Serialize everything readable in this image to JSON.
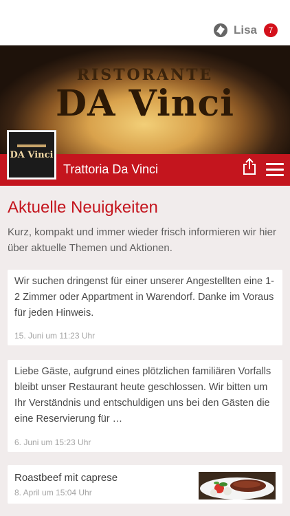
{
  "header": {
    "user_name": "Lisa",
    "notification_count": "7",
    "logo_icon": "lisa-app-icon"
  },
  "hero": {
    "sign_line1": "RISTORANTE",
    "sign_line2": "DA Vinci"
  },
  "business": {
    "name": "Trattoria Da Vinci",
    "logo_text": "DA Vinci",
    "share_icon": "share-icon",
    "menu_icon": "hamburger-menu-icon"
  },
  "news": {
    "title": "Aktuelle Neuigkeiten",
    "intro": "Kurz, kompakt und immer wieder frisch informieren wir hier über aktuelle Themen und Aktionen.",
    "items": [
      {
        "text": "Wir suchen dringenst für einer unserer Angestellten eine 1-2 Zimmer oder Appartment in Warendorf. Danke im Voraus für jeden Hinweis.",
        "date": "15. Juni um 11:23 Uhr"
      },
      {
        "text": "Liebe Gäste, aufgrund eines plötzlichen familiären Vorfalls bleibt unser Restaurant heute geschlossen. Wir bitten um Ihr Verständnis und entschuldigen uns bei den Gästen die eine Reservierung für …",
        "date": "6. Juni um 15:23 Uhr"
      },
      {
        "title": "Roastbeef mit caprese",
        "date": "8. April um 15:04 Uhr"
      }
    ]
  },
  "colors": {
    "brand_red": "#c4151e",
    "badge_red": "#d3111b",
    "background": "#f1ecec"
  }
}
